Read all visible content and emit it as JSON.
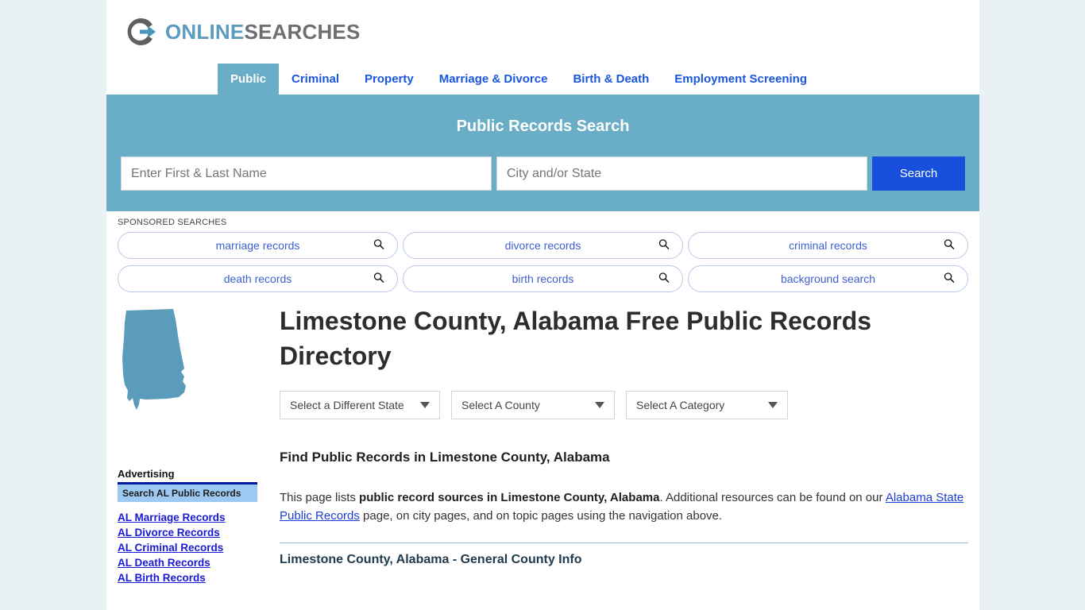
{
  "brand": {
    "online": "ONLINE",
    "searches": "SEARCHES",
    "logo_icon": "circle-arrow-icon"
  },
  "nav": {
    "items": [
      {
        "label": "Public",
        "active": true
      },
      {
        "label": "Criminal",
        "active": false
      },
      {
        "label": "Property",
        "active": false
      },
      {
        "label": "Marriage & Divorce",
        "active": false
      },
      {
        "label": "Birth & Death",
        "active": false
      },
      {
        "label": "Employment Screening",
        "active": false
      }
    ]
  },
  "hero": {
    "title": "Public Records Search",
    "name_placeholder": "Enter First & Last Name",
    "name_value": "",
    "place_placeholder": "City and/or State",
    "place_value": "",
    "search_label": "Search",
    "button_color": "#1850dd",
    "background_color": "#6aadc6"
  },
  "sponsored": {
    "label": "SPONSORED SEARCHES",
    "pills": [
      {
        "label": "marriage records",
        "icon": "search-icon"
      },
      {
        "label": "divorce records",
        "icon": "search-icon"
      },
      {
        "label": "criminal records",
        "icon": "search-icon"
      },
      {
        "label": "death records",
        "icon": "search-icon"
      },
      {
        "label": "birth records",
        "icon": "search-icon"
      },
      {
        "label": "background search",
        "icon": "search-icon"
      }
    ]
  },
  "main": {
    "state_map_icon": "alabama-state-map",
    "state_map_color": "#5b9cbc",
    "page_title": "Limestone County, Alabama Free Public Records Directory",
    "selects": [
      {
        "label": "Select a Different State"
      },
      {
        "label": "Select A County"
      },
      {
        "label": "Select A Category"
      }
    ],
    "section_heading": "Find Public Records in Limestone County, Alabama",
    "paragraph": {
      "part1": "This page lists ",
      "bold1": "public record sources in Limestone County, Alabama",
      "part2": ". Additional resources can be found on our ",
      "link1": "Alabama State Public Records",
      "part3": " page, on city pages, and on topic pages using the navigation above."
    },
    "sub_heading": "Limestone County, Alabama - General County Info"
  },
  "sidebar": {
    "ad_label": "Advertising",
    "ad_header": "Search AL Public Records",
    "links": [
      "AL Marriage Records",
      "AL Divorce Records",
      "AL Criminal Records",
      "AL Death Records",
      "AL Birth Records"
    ]
  }
}
